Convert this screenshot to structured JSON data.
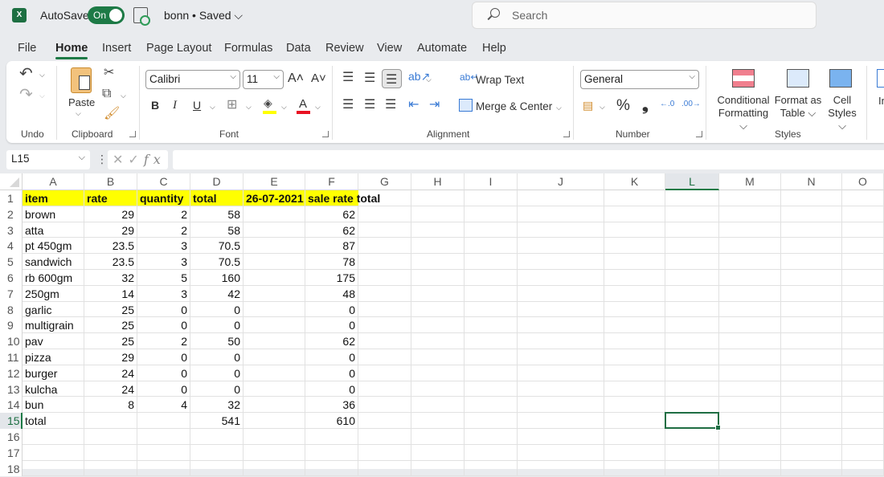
{
  "titlebar": {
    "app_icon": "excel-logo-icon",
    "app_letter": "X",
    "autosave_label": "AutoSave",
    "autosave_state": "On",
    "doc_title": "bonn • Saved ⌵",
    "search_placeholder": "Search"
  },
  "menu": [
    "File",
    "Home",
    "Insert",
    "Page Layout",
    "Formulas",
    "Data",
    "Review",
    "View",
    "Automate",
    "Help"
  ],
  "menu_active": "Home",
  "ribbon": {
    "groups": {
      "undo": "Undo",
      "clipboard": "Clipboard",
      "font": "Font",
      "alignment": "Alignment",
      "number": "Number",
      "styles": "Styles"
    },
    "paste_label": "Paste",
    "font_name": "Calibri",
    "font_size": "11",
    "grow_font": "A˄",
    "shrink_font": "A˅",
    "bold": "B",
    "italic": "I",
    "underline": "U",
    "font_color_letter": "A",
    "wrap_text": "Wrap Text",
    "merge_center": "Merge & Center",
    "number_format": "General",
    "percent": "%",
    "comma": "❟",
    "inc_decimal": "←.0",
    "dec_decimal": ".00→",
    "conditional_formatting": [
      "Conditional",
      "Formatting ⌵"
    ],
    "format_as_table": [
      "Format as",
      "Table ⌵"
    ],
    "cell_styles": [
      "Cell",
      "Styles ⌵"
    ],
    "insert_partial": "In",
    "colors": {
      "highlight": "#ffff00",
      "font_color": "#e81123",
      "accent": "#1d7a46"
    }
  },
  "formula_bar": {
    "name_box": "L15",
    "cancel": "✕",
    "enter": "✓",
    "fx": "fx",
    "formula": ""
  },
  "sheet": {
    "columns": [
      "A",
      "B",
      "C",
      "D",
      "E",
      "F",
      "G",
      "H",
      "I",
      "J",
      "K",
      "L",
      "M",
      "N",
      "O"
    ],
    "selected_column": "L",
    "selected_row": 15,
    "selected_cell": "L15",
    "row_numbers": [
      "1",
      "2",
      "3",
      "4",
      "5",
      "6",
      "7",
      "8",
      "9",
      "10",
      "11",
      "12",
      "13",
      "14",
      "15",
      "16",
      "17",
      "18"
    ],
    "header_row": [
      "item",
      "rate",
      "quantity",
      "total",
      "26-07-2021",
      "sale rate total"
    ],
    "rows": [
      {
        "item": "brown",
        "rate": "29",
        "quantity": "2",
        "total": "58",
        "date": "",
        "sale": "62"
      },
      {
        "item": "atta",
        "rate": "29",
        "quantity": "2",
        "total": "58",
        "date": "",
        "sale": "62"
      },
      {
        "item": "pt 450gm",
        "rate": "23.5",
        "quantity": "3",
        "total": "70.5",
        "date": "",
        "sale": "87"
      },
      {
        "item": "sandwich",
        "rate": "23.5",
        "quantity": "3",
        "total": "70.5",
        "date": "",
        "sale": "78"
      },
      {
        "item": "rb 600gm",
        "rate": "32",
        "quantity": "5",
        "total": "160",
        "date": "",
        "sale": "175"
      },
      {
        "item": "250gm",
        "rate": "14",
        "quantity": "3",
        "total": "42",
        "date": "",
        "sale": "48"
      },
      {
        "item": "garlic",
        "rate": "25",
        "quantity": "0",
        "total": "0",
        "date": "",
        "sale": "0"
      },
      {
        "item": "multigrain",
        "rate": "25",
        "quantity": "0",
        "total": "0",
        "date": "",
        "sale": "0"
      },
      {
        "item": "pav",
        "rate": "25",
        "quantity": "2",
        "total": "50",
        "date": "",
        "sale": "62"
      },
      {
        "item": "pizza",
        "rate": "29",
        "quantity": "0",
        "total": "0",
        "date": "",
        "sale": "0"
      },
      {
        "item": "burger",
        "rate": "24",
        "quantity": "0",
        "total": "0",
        "date": "",
        "sale": "0"
      },
      {
        "item": "kulcha",
        "rate": "24",
        "quantity": "0",
        "total": "0",
        "date": "",
        "sale": "0"
      },
      {
        "item": "bun",
        "rate": "8",
        "quantity": "4",
        "total": "32",
        "date": "",
        "sale": "36"
      },
      {
        "item": "total",
        "rate": "",
        "quantity": "",
        "total": "541",
        "date": "",
        "sale": "610"
      }
    ]
  }
}
